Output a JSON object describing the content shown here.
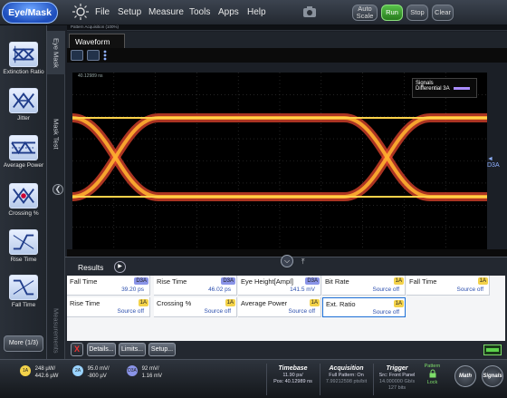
{
  "app_button": "Eye/Mask",
  "menu": [
    "File",
    "Setup",
    "Measure",
    "Tools",
    "Apps",
    "Help"
  ],
  "top_buttons": {
    "autoscale": "Auto Scale",
    "run": "Run",
    "stop": "Stop",
    "clear": "Clear"
  },
  "pattern_strip": "Pattern Acquisition  (100%)",
  "left_panel": {
    "items": [
      "Extinction Ratio",
      "Jitter",
      "Average Power",
      "Crossing %",
      "Rise Time",
      "Fall Time"
    ],
    "more": "More (1/3)"
  },
  "vtabs": {
    "eye_mask": "Eye Mask",
    "mask_test": "Mask Test",
    "measurements": "Measurements"
  },
  "waveform": {
    "tab": "Waveform",
    "time_readout": "40.12989 ns",
    "legend_title": "Signals",
    "legend_item": "Differential 3A",
    "ref_marker": "◄ D3A"
  },
  "results": {
    "tab": "Results",
    "rows": [
      [
        {
          "name": "Fall Time",
          "src": "D3A",
          "value": "39.20 ps"
        },
        {
          "name": "Rise Time",
          "src": "D3A",
          "value": "46.02 ps"
        },
        {
          "name": "Eye Height[Ampl]",
          "src": "D3A",
          "value": "141.5 mV"
        },
        {
          "name": "Bit Rate",
          "src": "1A",
          "value": "Source off"
        },
        {
          "name": "Fall Time",
          "src": "1A",
          "value": "Source off"
        }
      ],
      [
        {
          "name": "Rise Time",
          "src": "1A",
          "value": "Source off"
        },
        {
          "name": "Crossing %",
          "src": "1A",
          "value": "Source off"
        },
        {
          "name": "Average Power",
          "src": "1A",
          "value": "Source off"
        },
        {
          "name": "Ext. Ratio",
          "src": "1A",
          "value": "Source off"
        }
      ]
    ],
    "buttons": {
      "delete": "X",
      "details": "Details...",
      "limits": "Limits...",
      "setup": "Setup..."
    }
  },
  "bottom": {
    "chan1": {
      "badge": "1A",
      "line1": "248 µW/",
      "line2": "442.6 µW"
    },
    "chan2": {
      "badge": "2A",
      "line1": "95.0 mV/",
      "line2": "-800 µV"
    },
    "chan3": {
      "badge": "D3A",
      "line1": "92 mV/",
      "line2": "1.16 mV"
    },
    "timebase": {
      "h": "Timebase",
      "l1": "11.90 ps/",
      "l2": "Pos: 40.12989 ns"
    },
    "acquisition": {
      "h": "Acquisition",
      "l1": "Full Pattern: On",
      "l2": "7.99212598 pts/bit"
    },
    "trigger": {
      "h": "Trigger",
      "l1": "Src: Front Panel",
      "l2": "14.000000 Gb/s",
      "l3": "127 bits"
    },
    "pattern_lock": {
      "l1": "Pattern",
      "l2": "Lock"
    },
    "math": "Math",
    "signals": "Signals"
  },
  "colors": {
    "accent": "#1f4fbd",
    "run": "#3aa02e",
    "d3a_badge": "#8a94e8",
    "src_1a": "#f3d24a"
  }
}
